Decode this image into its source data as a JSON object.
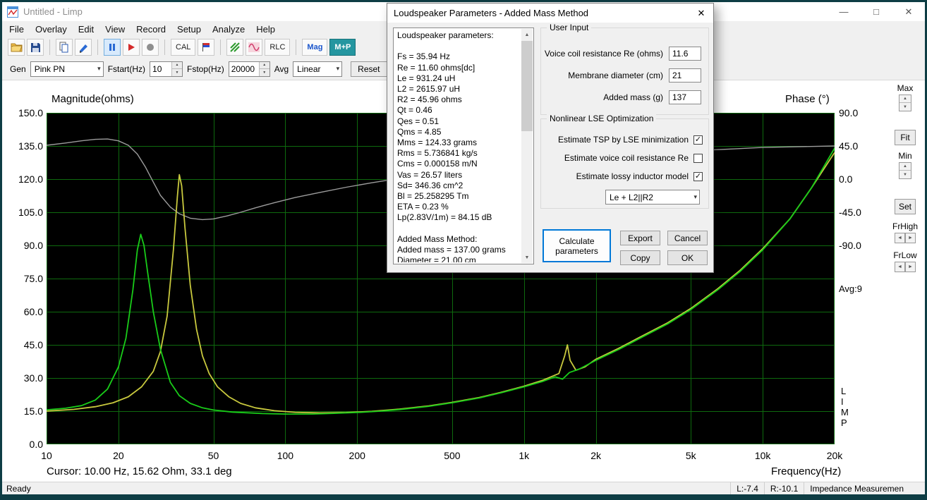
{
  "window": {
    "title": "Untitled - Limp",
    "minimize_glyph": "—",
    "maximize_glyph": "□",
    "close_glyph": "✕"
  },
  "menubar": {
    "items": [
      "File",
      "Overlay",
      "Edit",
      "View",
      "Record",
      "Setup",
      "Analyze",
      "Help"
    ]
  },
  "toolbar": {
    "cal": "CAL",
    "rlc": "RLC",
    "mag": "Mag",
    "mp": "M+P"
  },
  "generator_bar": {
    "gen_label": "Gen",
    "gen_value": "Pink PN",
    "fstart_label": "Fstart(Hz)",
    "fstart_value": "10",
    "fstop_label": "Fstop(Hz)",
    "fstop_value": "20000",
    "avg_label": "Avg",
    "avg_value": "Linear",
    "reset_label": "Reset"
  },
  "scale_panel": {
    "max_label": "Max",
    "fit_label": "Fit",
    "min_label": "Min",
    "set_label": "Set",
    "frhigh_label": "FrHigh",
    "frlow_label": "FrLow",
    "avg_text": "Avg:9",
    "logo_letters": [
      "L",
      "I",
      "M",
      "P"
    ]
  },
  "chart": {
    "cursor_text": "Cursor: 10.00 Hz, 15.62 Ohm, 33.1 deg"
  },
  "chart_data": {
    "type": "line",
    "x_axis": {
      "label": "Frequency(Hz)",
      "scale": "log",
      "min": 10,
      "max": 20000,
      "tick_values": [
        10,
        20,
        50,
        100,
        200,
        500,
        1000,
        2000,
        5000,
        10000,
        20000
      ],
      "tick_labels": [
        "10",
        "20",
        "50",
        "100",
        "200",
        "500",
        "1k",
        "2k",
        "5k",
        "10k",
        "20k"
      ]
    },
    "y_axis_left": {
      "label": "Magnitude(ohms)",
      "min": 0,
      "max": 150,
      "step": 15,
      "tick_labels": [
        "150.0",
        "135.0",
        "120.0",
        "105.0",
        "90.0",
        "75.0",
        "60.0",
        "45.0",
        "30.0",
        "15.0",
        "0.0"
      ]
    },
    "y_axis_right": {
      "label": "Phase (°)",
      "min": -90,
      "max": 90,
      "step": 45,
      "tick_values": [
        90,
        45,
        0,
        -45,
        -90
      ],
      "tick_labels": [
        "90.0",
        "45.0",
        "0.0",
        "-45.0",
        "-90.0"
      ],
      "note": "phase scale spans top 40% of plot (maps onto 90-150 ohm band)"
    },
    "grid": {
      "color": "#0e6a0e",
      "background": "#000000",
      "legend": "none"
    },
    "series": [
      {
        "name": "phase",
        "axis": "right",
        "color": "#9c9c9c",
        "points": [
          [
            10,
            46
          ],
          [
            12,
            49
          ],
          [
            14,
            52
          ],
          [
            16,
            54
          ],
          [
            18,
            54.5
          ],
          [
            20,
            52
          ],
          [
            22,
            46
          ],
          [
            24,
            34
          ],
          [
            26,
            16
          ],
          [
            28,
            -4
          ],
          [
            30,
            -22
          ],
          [
            33,
            -38
          ],
          [
            36,
            -47
          ],
          [
            40,
            -53
          ],
          [
            45,
            -55
          ],
          [
            50,
            -54
          ],
          [
            57,
            -50
          ],
          [
            65,
            -45
          ],
          [
            75,
            -39
          ],
          [
            90,
            -32
          ],
          [
            110,
            -25
          ],
          [
            140,
            -18
          ],
          [
            180,
            -11
          ],
          [
            230,
            -5
          ],
          [
            300,
            1
          ],
          [
            400,
            7
          ],
          [
            500,
            11
          ],
          [
            650,
            15
          ],
          [
            800,
            18
          ],
          [
            1000,
            21
          ],
          [
            1300,
            25
          ],
          [
            1700,
            28
          ],
          [
            2200,
            31
          ],
          [
            3000,
            34
          ],
          [
            4000,
            37
          ],
          [
            5500,
            39
          ],
          [
            7500,
            41
          ],
          [
            10000,
            43
          ],
          [
            14000,
            44
          ],
          [
            20000,
            45
          ]
        ]
      },
      {
        "name": "impedance-overlay",
        "axis": "left",
        "color": "#c9c93e",
        "points": [
          [
            10,
            15
          ],
          [
            13,
            15.8
          ],
          [
            16,
            17
          ],
          [
            19,
            18.8
          ],
          [
            22,
            21.5
          ],
          [
            25,
            26
          ],
          [
            28,
            33
          ],
          [
            30,
            42
          ],
          [
            32,
            58
          ],
          [
            34,
            88
          ],
          [
            35.3,
            112
          ],
          [
            36,
            122
          ],
          [
            36.8,
            117
          ],
          [
            38,
            98
          ],
          [
            40,
            72
          ],
          [
            42.5,
            52
          ],
          [
            45,
            40
          ],
          [
            48,
            32
          ],
          [
            52,
            26
          ],
          [
            58,
            21.5
          ],
          [
            65,
            18.5
          ],
          [
            75,
            16.5
          ],
          [
            90,
            15.2
          ],
          [
            110,
            14.5
          ],
          [
            140,
            14.2
          ],
          [
            180,
            14.4
          ],
          [
            230,
            14.9
          ],
          [
            300,
            15.9
          ],
          [
            400,
            17.4
          ],
          [
            500,
            19
          ],
          [
            650,
            21.2
          ],
          [
            800,
            23.5
          ],
          [
            1000,
            26.3
          ],
          [
            1200,
            29
          ],
          [
            1400,
            32
          ],
          [
            1480,
            40
          ],
          [
            1520,
            45
          ],
          [
            1560,
            38
          ],
          [
            1650,
            33.5
          ],
          [
            1800,
            35
          ],
          [
            2000,
            38.5
          ],
          [
            2500,
            43.5
          ],
          [
            3000,
            48
          ],
          [
            4000,
            55
          ],
          [
            5000,
            61.5
          ],
          [
            6500,
            70.5
          ],
          [
            8000,
            78.5
          ],
          [
            10000,
            88.5
          ],
          [
            13000,
            102
          ],
          [
            16000,
            116
          ],
          [
            20000,
            132
          ]
        ]
      },
      {
        "name": "impedance-current",
        "axis": "left",
        "color": "#19cc19",
        "points": [
          [
            10,
            15.6
          ],
          [
            12,
            16.3
          ],
          [
            14,
            17.5
          ],
          [
            16,
            20
          ],
          [
            18,
            25
          ],
          [
            20,
            35
          ],
          [
            21.5,
            48
          ],
          [
            23,
            70
          ],
          [
            24,
            88
          ],
          [
            24.8,
            95
          ],
          [
            25.6,
            90
          ],
          [
            26.5,
            78
          ],
          [
            28,
            60
          ],
          [
            30,
            43
          ],
          [
            33,
            28
          ],
          [
            36,
            22
          ],
          [
            40,
            18.5
          ],
          [
            45,
            16.5
          ],
          [
            50,
            15.5
          ],
          [
            60,
            14.6
          ],
          [
            80,
            13.9
          ],
          [
            100,
            13.7
          ],
          [
            130,
            13.7
          ],
          [
            160,
            14
          ],
          [
            200,
            14.4
          ],
          [
            250,
            15
          ],
          [
            300,
            15.7
          ],
          [
            400,
            17.2
          ],
          [
            500,
            18.8
          ],
          [
            650,
            21
          ],
          [
            800,
            23.3
          ],
          [
            1000,
            26
          ],
          [
            1200,
            28.5
          ],
          [
            1350,
            30.5
          ],
          [
            1450,
            29.5
          ],
          [
            1550,
            32.5
          ],
          [
            1700,
            34
          ],
          [
            2000,
            38
          ],
          [
            2500,
            43
          ],
          [
            3000,
            47.5
          ],
          [
            4000,
            54.5
          ],
          [
            5000,
            61
          ],
          [
            6500,
            70
          ],
          [
            8000,
            78
          ],
          [
            10000,
            88
          ],
          [
            13000,
            102
          ],
          [
            16000,
            116
          ],
          [
            20000,
            134
          ]
        ]
      }
    ]
  },
  "statusbar": {
    "ready": "Ready",
    "left_level": "L:-7.4",
    "right_level": "R:-10.1",
    "mode": "Impedance Measuremen"
  },
  "dialog": {
    "title": "Loudspeaker Parameters - Added Mass Method",
    "close_glyph": "✕",
    "parameters_text": [
      "Loudspeaker parameters:",
      "",
      "Fs = 35.94 Hz",
      "Re = 11.60 ohms[dc]",
      "Le = 931.24 uH",
      "L2 = 2615.97 uH",
      "R2 = 45.96 ohms",
      "Qt = 0.46",
      "Qes = 0.51",
      "Qms = 4.85",
      "Mms = 124.33 grams",
      "Rms = 5.736841 kg/s",
      "Cms = 0.000158 m/N",
      "Vas = 26.57 liters",
      "Sd= 346.36 cm^2",
      "Bl = 25.258295 Tm",
      "ETA = 0.23 %",
      "Lp(2.83V/1m) = 84.15 dB",
      "",
      "Added Mass Method:",
      "Added mass = 137.00 grams",
      "Diameter = 21.00 cm"
    ],
    "user_input": {
      "title": "User Input",
      "fields": [
        {
          "label": "Voice coil resistance Re (ohms)",
          "value": "11.6"
        },
        {
          "label": "Membrane diameter (cm)",
          "value": "21"
        },
        {
          "label": "Added mass (g)",
          "value": "137"
        }
      ]
    },
    "nonlinear": {
      "title": "Nonlinear LSE Optimization",
      "checks": [
        {
          "label": "Estimate TSP by LSE minimization",
          "checked": true
        },
        {
          "label": "Estimate voice coil resistance Re",
          "checked": false
        },
        {
          "label": "Estimate lossy inductor model",
          "checked": true
        }
      ],
      "model_value": "Le + L2||R2"
    },
    "buttons": {
      "calculate": "Calculate parameters",
      "export": "Export",
      "cancel": "Cancel",
      "copy": "Copy",
      "ok": "OK"
    }
  }
}
